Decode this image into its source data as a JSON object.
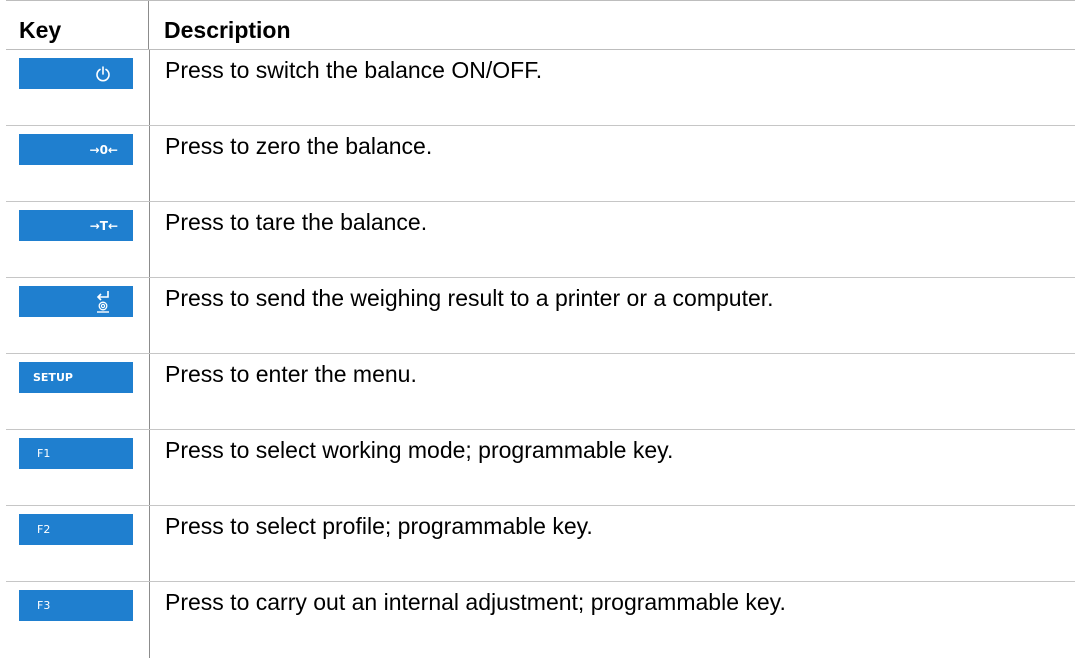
{
  "table": {
    "headers": {
      "key": "Key",
      "description": "Description"
    },
    "rows": [
      {
        "key_label": "",
        "key_icon": "power-icon",
        "description": "Press to switch the balance ON/OFF."
      },
      {
        "key_label": "→0←",
        "key_icon": "zero-icon",
        "description": "Press to zero the balance."
      },
      {
        "key_label": "→T←",
        "key_icon": "tare-icon",
        "description": "Press to tare the balance."
      },
      {
        "key_label": "",
        "key_icon": "print-enter-icon",
        "description": "Press to send the weighing result to a printer or a computer."
      },
      {
        "key_label": "SETUP",
        "key_icon": "",
        "description": "Press to enter the menu."
      },
      {
        "key_label": "F1",
        "key_icon": "",
        "description": "Press to select working mode; programmable key."
      },
      {
        "key_label": "F2",
        "key_icon": "",
        "description": "Press to select profile; programmable key."
      },
      {
        "key_label": "F3",
        "key_icon": "",
        "description": "Press to carry out an internal adjustment; programmable key."
      }
    ]
  },
  "colors": {
    "key_blue": "#1f7fcf",
    "key_text": "#ffffff"
  }
}
